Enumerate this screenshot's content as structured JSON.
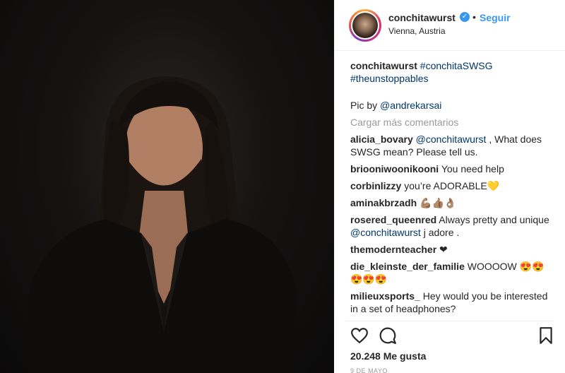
{
  "post": {
    "username": "conchitawurst",
    "verified_icon": "✓",
    "dot": "•",
    "follow_label": "Seguir",
    "location": "Vienna, Austria",
    "caption_user": "conchitawurst",
    "caption_tags_1": "#conchitaSWSG",
    "caption_tags_2": "#theunstoppables",
    "pic_by_prefix": "Pic by ",
    "pic_by_link": "@andrekarsai",
    "load_more": "Cargar más comentarios",
    "likes": "20.248 Me gusta",
    "date": "9 DE MAYO"
  },
  "comments": [
    {
      "user": "alicia_bovary",
      "mention": "@conchitawurst",
      "text": " , What does SWSG mean? Please tell us."
    },
    {
      "user": "briooniwoonikooni",
      "mention": "",
      "text": "You need help"
    },
    {
      "user": "corbinlizzy",
      "mention": "",
      "text": "you’re ADORABLE💛"
    },
    {
      "user": "aminakbrzadh",
      "mention": "",
      "text": "💪🏽👍🏽👌🏽"
    },
    {
      "user": "rosered_queenred",
      "mention": "",
      "text": "Always pretty and unique ",
      "mention2": "@conchitawurst",
      "text2": " j adore ."
    },
    {
      "user": "themodernteacher",
      "mention": "",
      "text": "❤"
    },
    {
      "user": "die_kleinste_der_familie",
      "mention": "",
      "text": "WOOOOW 😍😍😍😍😍"
    },
    {
      "user": "milieuxsports_",
      "mention": "",
      "text": "Hey would you be interested in a set of headphones?"
    }
  ],
  "icons": {
    "like": "heart-icon",
    "comment": "comment-icon",
    "save": "bookmark-icon"
  },
  "colors": {
    "accent": "#3897f0",
    "link": "#003569",
    "muted": "#999999"
  }
}
